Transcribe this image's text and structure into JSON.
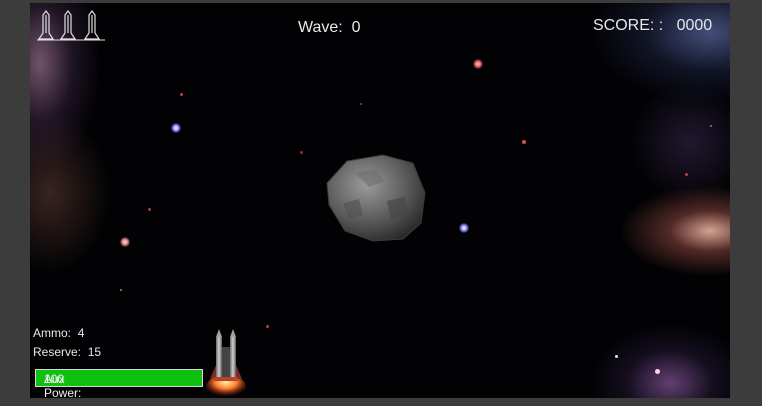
{
  "hud": {
    "wave_label": "Wave:",
    "wave_value": "0",
    "score_label": "SCORE: :",
    "score_value": "0000",
    "ammo_label": "Ammo:",
    "ammo_value": "4",
    "reserve_label": "Reserve:",
    "reserve_value": "15",
    "aux_power_label": "Aux Power:",
    "aux_power_value": "100",
    "aux_power_fraction": 1.0,
    "lives_count": 3
  },
  "colors": {
    "hud_text": "#e8e8e8",
    "aux_bar": "#10c010",
    "frame": "#3c3c3c"
  },
  "icons": {
    "lives": "ship-life-icon",
    "player": "player-ship-icon",
    "enemy": "asteroid-icon"
  }
}
